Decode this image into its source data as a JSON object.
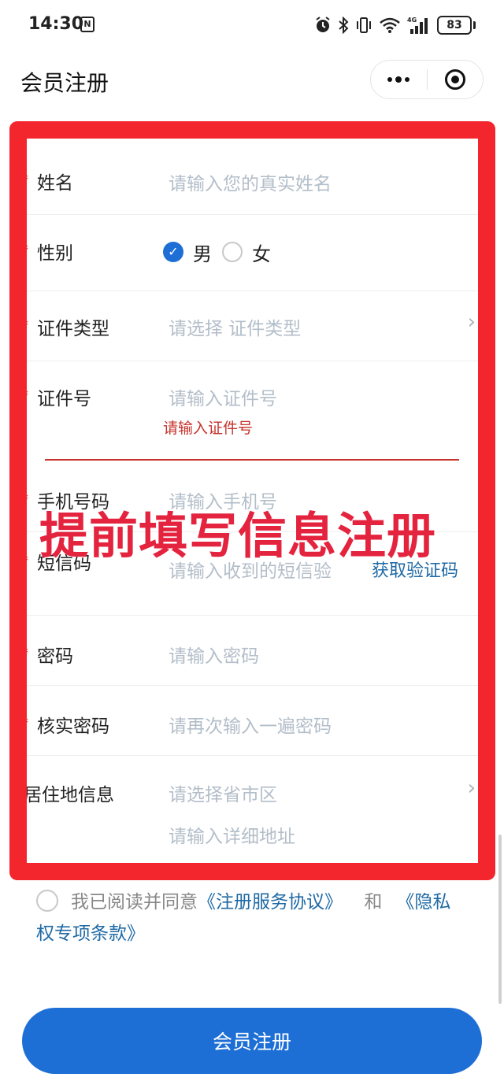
{
  "status_bar": {
    "time": "14:30",
    "nfc_glyph": "N",
    "battery": "83",
    "icons": [
      "alarm-icon",
      "bluetooth-icon",
      "vibrate-icon",
      "wifi-icon",
      "signal-4g-icon",
      "battery-icon"
    ]
  },
  "nav": {
    "title": "会员注册",
    "more_icon": "more-dots-icon",
    "close_icon": "target-close-icon"
  },
  "form": {
    "name": {
      "label": "姓名",
      "placeholder": "请输入您的真实姓名"
    },
    "gender": {
      "label": "性别",
      "options": [
        "男",
        "女"
      ],
      "selected": "男"
    },
    "id_type": {
      "label": "证件类型",
      "placeholder": "请选择 证件类型"
    },
    "id_number": {
      "label": "证件号",
      "placeholder": "请输入证件号",
      "error": "请输入证件号"
    },
    "phone": {
      "label": "手机号码",
      "placeholder": "请输入手机号"
    },
    "sms": {
      "label": "短信码",
      "placeholder": "请输入收到的短信验",
      "action": "获取验证码"
    },
    "password": {
      "label": "密码",
      "placeholder": "请输入密码"
    },
    "confirm_password": {
      "label": "核实密码",
      "placeholder": "请再次输入一遍密码"
    },
    "address": {
      "label": "居住地信息",
      "region_placeholder": "请选择省市区",
      "detail_placeholder": "请输入详细地址"
    },
    "required_mark": "*"
  },
  "overlay": {
    "text": "提前填写信息注册",
    "color": "#e4243f",
    "box_color": "#f2262c"
  },
  "agreement": {
    "prefix": "我已阅读并同意",
    "service_link": "《注册服务协议》",
    "and": "和",
    "privacy_link_part1": "《隐私",
    "privacy_link_part2": "权专项条款》"
  },
  "submit": {
    "label": "会员注册",
    "color": "#1d6fd6"
  }
}
